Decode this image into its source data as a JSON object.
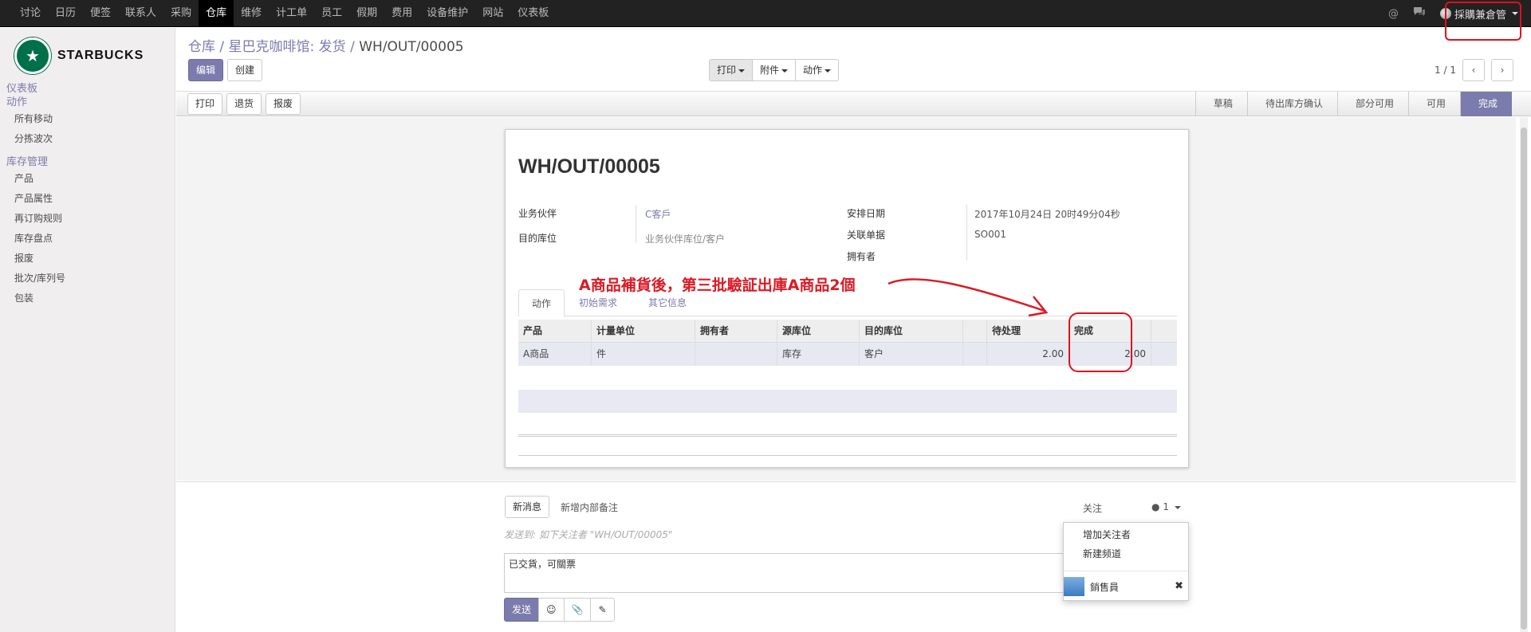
{
  "topbar": {
    "menu": [
      "讨论",
      "日历",
      "便签",
      "联系人",
      "采购",
      "仓库",
      "维修",
      "计工单",
      "员工",
      "假期",
      "费用",
      "设备维护",
      "网站",
      "仪表板"
    ],
    "active_menu": "仓库",
    "user": "採購兼倉管",
    "at_icon": "@"
  },
  "logo": {
    "text": "STARBUCKS",
    "mark": "★"
  },
  "sidebar": {
    "sec1": "仪表板",
    "sec2": "动作",
    "items1": [
      "所有移动",
      "分拣波次"
    ],
    "sec3": "库存管理",
    "items2": [
      "产品",
      "产品属性",
      "再订购规则",
      "库存盘点",
      "报废",
      "批次/库列号",
      "包装"
    ]
  },
  "breadcrumb": {
    "part1": "仓库",
    "part2": "星巴克咖啡馆: 发货",
    "current": "WH/OUT/00005",
    "sep": "/"
  },
  "actions": {
    "edit": "编辑",
    "create": "创建",
    "print": "打印",
    "attach": "附件",
    "action": "动作"
  },
  "pager": {
    "text": "1 / 1"
  },
  "statusbar": {
    "buttons": [
      "打印",
      "退货",
      "报废"
    ],
    "stages": [
      "草稿",
      "待出库方确认",
      "部分可用",
      "可用",
      "完成"
    ],
    "active_stage": "完成"
  },
  "document": {
    "title": "WH/OUT/00005",
    "partner_label": "业务伙伴",
    "partner_value": "C客戶",
    "dest_label": "目的库位",
    "dest_value": "业务伙伴库位/客户",
    "sched_label": "安排日期",
    "sched_value": "2017年10月24日 20时49分04秒",
    "origin_label": "关联单据",
    "origin_value": "SO001",
    "owner_label": "拥有者",
    "tabs": [
      "动作",
      "初始需求",
      "其它信息"
    ]
  },
  "table": {
    "headers": [
      "产品",
      "计量单位",
      "拥有者",
      "源库位",
      "目的库位",
      "",
      "待处理",
      "完成"
    ],
    "row": [
      "A商品",
      "件",
      "",
      "库存",
      "客户",
      "",
      "2.00",
      "2.00"
    ]
  },
  "annotation": "A商品補貨後，第三批驗証出庫A商品2個",
  "chatter": {
    "new_message": "新消息",
    "log_note": "新增内部备注",
    "follow": "关注",
    "follower_count": "1",
    "send_to": "发送到: 如下关注者 \"WH/OUT/00005\"",
    "message": "已交貨，可關票",
    "send": "发送",
    "dropdown": [
      "增加关注者",
      "新建频道"
    ],
    "follower_name": "銷售員"
  },
  "colors": {
    "accent": "#7c7bad",
    "annot": "#d91b25"
  }
}
